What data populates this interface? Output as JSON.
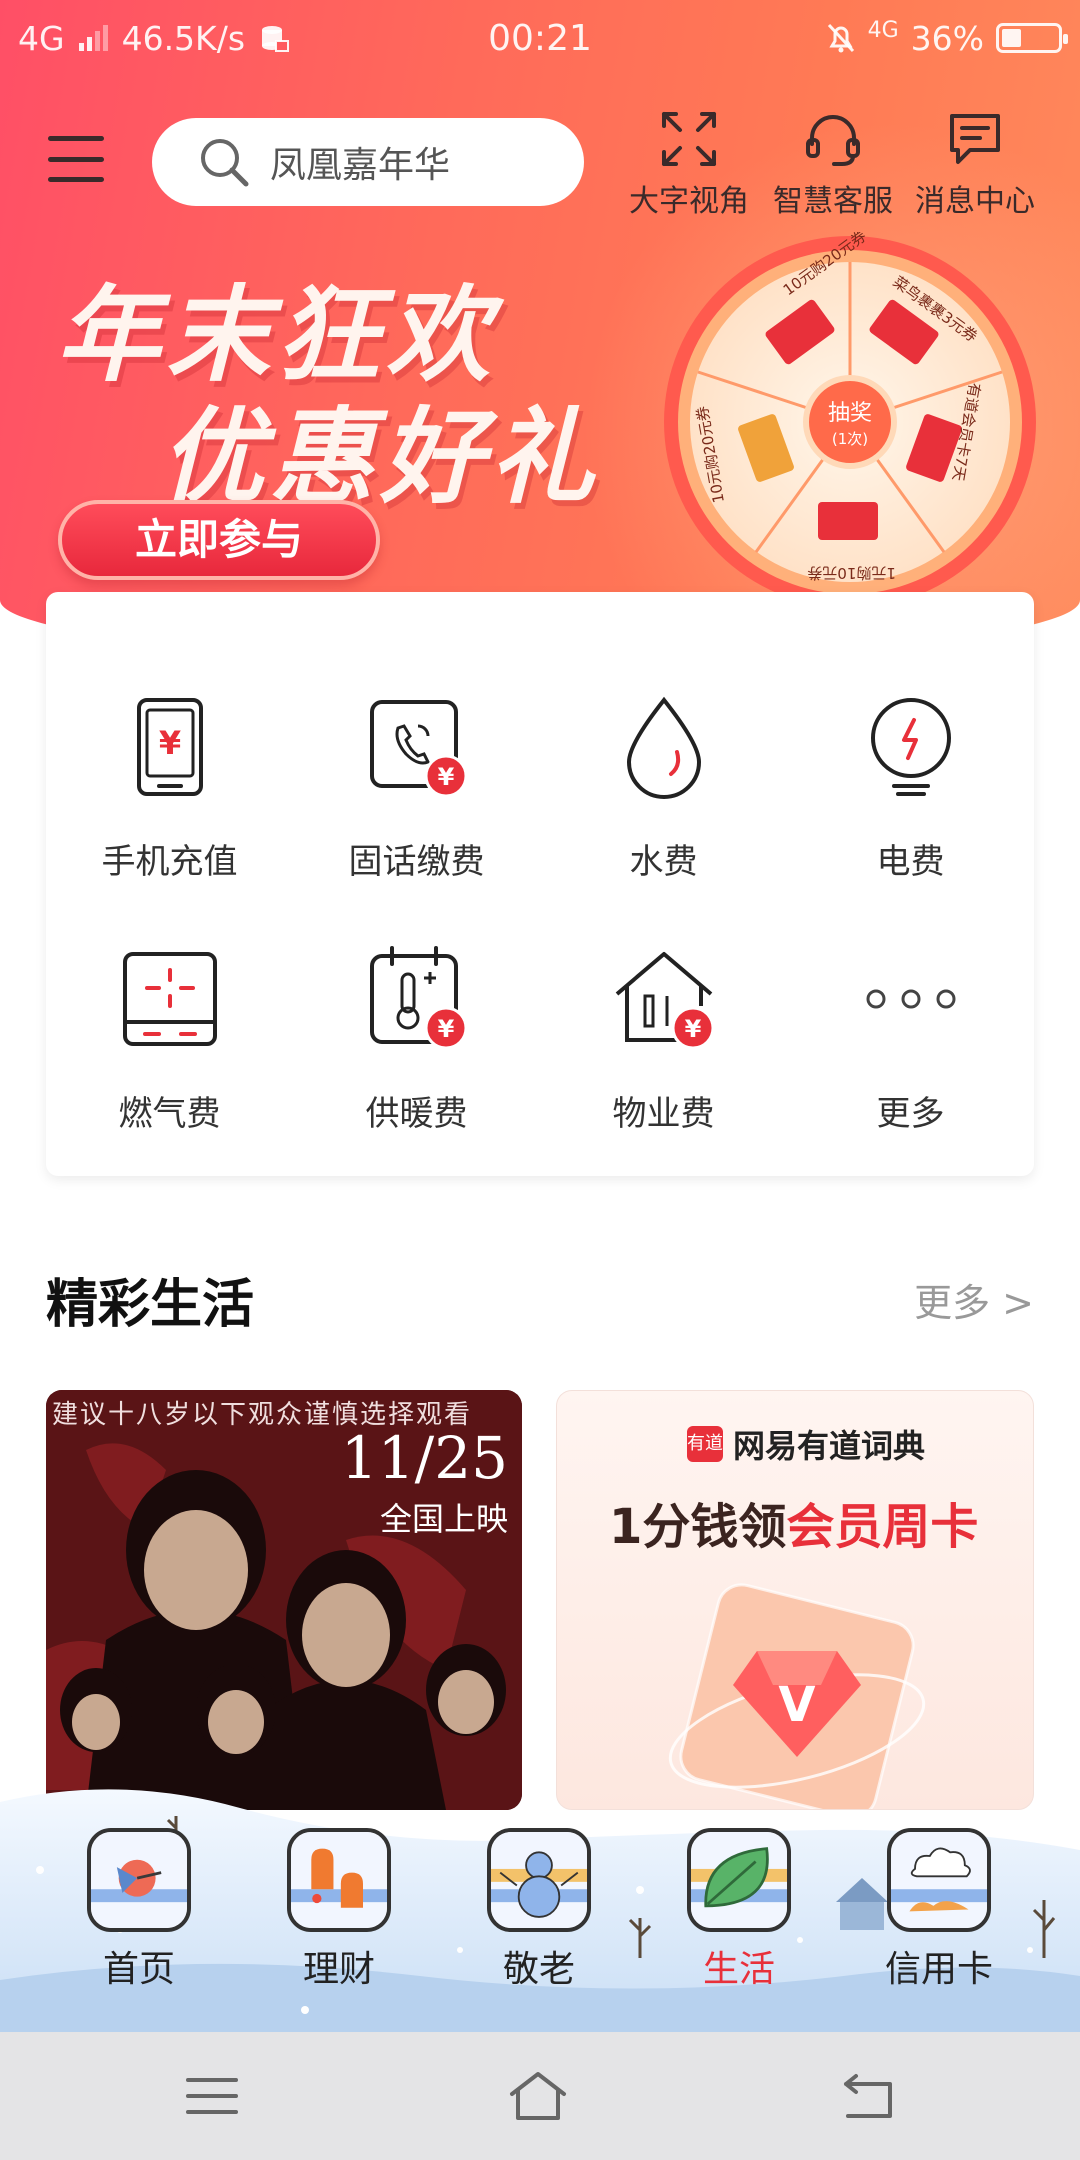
{
  "status_bar": {
    "network": "4G",
    "speed": "46.5K/s",
    "time": "00:21",
    "network_right": "4G",
    "battery": "36%"
  },
  "top_nav": {
    "search_placeholder": "凤凰嘉年华",
    "actions": [
      {
        "label": "大字视角",
        "icon": "expand-icon"
      },
      {
        "label": "智慧客服",
        "icon": "headset-icon"
      },
      {
        "label": "消息中心",
        "icon": "message-icon"
      }
    ]
  },
  "banner": {
    "title_line1": "年末狂欢",
    "title_line2": "优惠好礼",
    "button_label": "立即参与",
    "wheel_center": "抽奖",
    "wheel_center_sub": "(1次)",
    "wheel_sectors": [
      "10元购20元券",
      "菜鸟裹裹3元券",
      "有道会员卡7天",
      "1元购10元券",
      "10元购20元券"
    ]
  },
  "services": [
    {
      "label": "手机充值",
      "icon": "phone-recharge-icon"
    },
    {
      "label": "固话缴费",
      "icon": "landline-fee-icon"
    },
    {
      "label": "水费",
      "icon": "water-drop-icon"
    },
    {
      "label": "电费",
      "icon": "electricity-icon"
    },
    {
      "label": "燃气费",
      "icon": "gas-stove-icon"
    },
    {
      "label": "供暖费",
      "icon": "heating-icon"
    },
    {
      "label": "物业费",
      "icon": "property-house-icon"
    },
    {
      "label": "更多",
      "icon": "more-dots-icon"
    }
  ],
  "section": {
    "title": "精彩生活",
    "more": "更多 >"
  },
  "cards": {
    "movie": {
      "advisory": "建议十八岁以下观众谨慎选择观看",
      "date": "11/25",
      "release": "全国上映"
    },
    "youdao": {
      "logo": "有道",
      "brand": "网易有道词典",
      "promo_prefix": "1分钱领",
      "promo_highlight": "会员周卡",
      "gem_letter": "V"
    }
  },
  "tabs": [
    {
      "label": "首页",
      "active": false
    },
    {
      "label": "理财",
      "active": false
    },
    {
      "label": "敬老",
      "active": false
    },
    {
      "label": "生活",
      "active": true
    },
    {
      "label": "信用卡",
      "active": false
    }
  ],
  "colors": {
    "brand_red": "#e8303a",
    "header_gradient_start": "#ff4f66",
    "header_gradient_end": "#ff8a5c"
  }
}
